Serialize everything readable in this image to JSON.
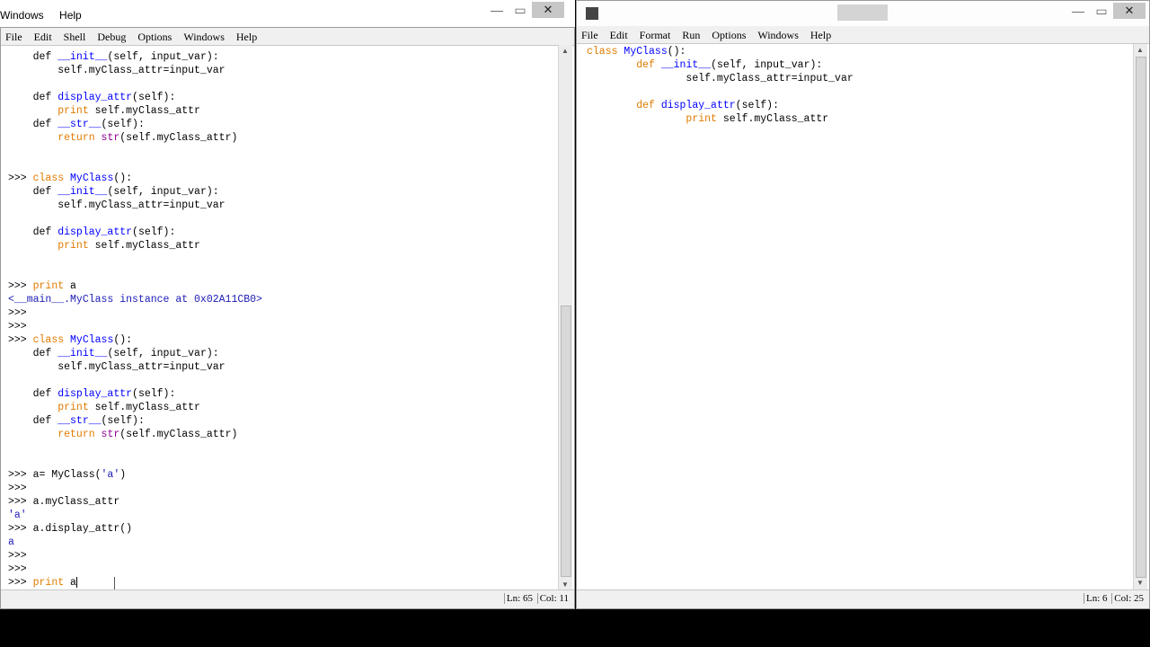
{
  "background_strip": {
    "menu": [
      "Windows",
      "Help"
    ]
  },
  "shell": {
    "menu": [
      "File",
      "Edit",
      "Shell",
      "Debug",
      "Options",
      "Windows",
      "Help"
    ],
    "lines": [
      [
        [
          "d",
          "    def "
        ],
        [
          "n",
          "__init__"
        ],
        [
          "d",
          "(self, input_var):"
        ]
      ],
      [
        [
          "d",
          "        self.myClass_attr=input_var"
        ]
      ],
      [
        [
          "d",
          ""
        ]
      ],
      [
        [
          "d",
          "    def "
        ],
        [
          "n",
          "display_attr"
        ],
        [
          "d",
          "(self):"
        ]
      ],
      [
        [
          "d",
          "        "
        ],
        [
          "k",
          "print"
        ],
        [
          "d",
          " self.myClass_attr"
        ]
      ],
      [
        [
          "d",
          "    def "
        ],
        [
          "n",
          "__str__"
        ],
        [
          "d",
          "(self):"
        ]
      ],
      [
        [
          "d",
          "        "
        ],
        [
          "k",
          "return"
        ],
        [
          "d",
          " "
        ],
        [
          "b",
          "str"
        ],
        [
          "d",
          "(self.myClass_attr)"
        ]
      ],
      [
        [
          "d",
          ""
        ]
      ],
      [
        [
          "d",
          ""
        ]
      ],
      [
        [
          "d",
          ">>> "
        ],
        [
          "k",
          "class"
        ],
        [
          "d",
          " "
        ],
        [
          "n",
          "MyClass"
        ],
        [
          "d",
          "():"
        ]
      ],
      [
        [
          "d",
          "    def "
        ],
        [
          "n",
          "__init__"
        ],
        [
          "d",
          "(self, input_var):"
        ]
      ],
      [
        [
          "d",
          "        self.myClass_attr=input_var"
        ]
      ],
      [
        [
          "d",
          ""
        ]
      ],
      [
        [
          "d",
          "    def "
        ],
        [
          "n",
          "display_attr"
        ],
        [
          "d",
          "(self):"
        ]
      ],
      [
        [
          "d",
          "        "
        ],
        [
          "k",
          "print"
        ],
        [
          "d",
          " self.myClass_attr"
        ]
      ],
      [
        [
          "d",
          ""
        ]
      ],
      [
        [
          "d",
          ""
        ]
      ],
      [
        [
          "d",
          ">>> "
        ],
        [
          "k",
          "print"
        ],
        [
          "d",
          " a"
        ]
      ],
      [
        [
          "o",
          "<__main__.MyClass instance at 0x02A11CB0>"
        ]
      ],
      [
        [
          "d",
          ">>>"
        ]
      ],
      [
        [
          "d",
          ">>>"
        ]
      ],
      [
        [
          "d",
          ">>> "
        ],
        [
          "k",
          "class"
        ],
        [
          "d",
          " "
        ],
        [
          "n",
          "MyClass"
        ],
        [
          "d",
          "():"
        ]
      ],
      [
        [
          "d",
          "    def "
        ],
        [
          "n",
          "__init__"
        ],
        [
          "d",
          "(self, input_var):"
        ]
      ],
      [
        [
          "d",
          "        self.myClass_attr=input_var"
        ]
      ],
      [
        [
          "d",
          ""
        ]
      ],
      [
        [
          "d",
          "    def "
        ],
        [
          "n",
          "display_attr"
        ],
        [
          "d",
          "(self):"
        ]
      ],
      [
        [
          "d",
          "        "
        ],
        [
          "k",
          "print"
        ],
        [
          "d",
          " self.myClass_attr"
        ]
      ],
      [
        [
          "d",
          "    def "
        ],
        [
          "n",
          "__str__"
        ],
        [
          "d",
          "(self):"
        ]
      ],
      [
        [
          "d",
          "        "
        ],
        [
          "k",
          "return"
        ],
        [
          "d",
          " "
        ],
        [
          "b",
          "str"
        ],
        [
          "d",
          "(self.myClass_attr)"
        ]
      ],
      [
        [
          "d",
          ""
        ]
      ],
      [
        [
          "d",
          ""
        ]
      ],
      [
        [
          "d",
          ">>> a= MyClass("
        ],
        [
          "s",
          "'a'"
        ],
        [
          "d",
          ")"
        ]
      ],
      [
        [
          "d",
          ">>>"
        ]
      ],
      [
        [
          "d",
          ">>> a.myClass_attr"
        ]
      ],
      [
        [
          "o",
          "'a'"
        ]
      ],
      [
        [
          "d",
          ">>> a.display_attr()"
        ]
      ],
      [
        [
          "o",
          "a"
        ]
      ],
      [
        [
          "d",
          ">>>"
        ]
      ],
      [
        [
          "d",
          ">>>"
        ]
      ],
      [
        [
          "d",
          ">>> "
        ],
        [
          "k",
          "print"
        ],
        [
          "d",
          " a"
        ]
      ]
    ],
    "status": {
      "ln": "Ln: 65",
      "col": "Col: 11"
    }
  },
  "editor": {
    "menu": [
      "File",
      "Edit",
      "Format",
      "Run",
      "Options",
      "Windows",
      "Help"
    ],
    "lines": [
      [
        [
          "k",
          "class"
        ],
        [
          "d",
          " "
        ],
        [
          "n",
          "MyClass"
        ],
        [
          "d",
          "():"
        ]
      ],
      [
        [
          "d",
          "        "
        ],
        [
          "k",
          "def"
        ],
        [
          "d",
          " "
        ],
        [
          "n",
          "__init__"
        ],
        [
          "d",
          "(self, input_var):"
        ]
      ],
      [
        [
          "d",
          "                self.myClass_attr=input_var"
        ]
      ],
      [
        [
          "d",
          ""
        ]
      ],
      [
        [
          "d",
          "        "
        ],
        [
          "k",
          "def"
        ],
        [
          "d",
          " "
        ],
        [
          "n",
          "display_attr"
        ],
        [
          "d",
          "(self):"
        ]
      ],
      [
        [
          "d",
          "                "
        ],
        [
          "k",
          "print"
        ],
        [
          "d",
          " self.myClass_attr"
        ]
      ]
    ],
    "status": {
      "ln": "Ln: 6",
      "col": "Col: 25"
    }
  }
}
